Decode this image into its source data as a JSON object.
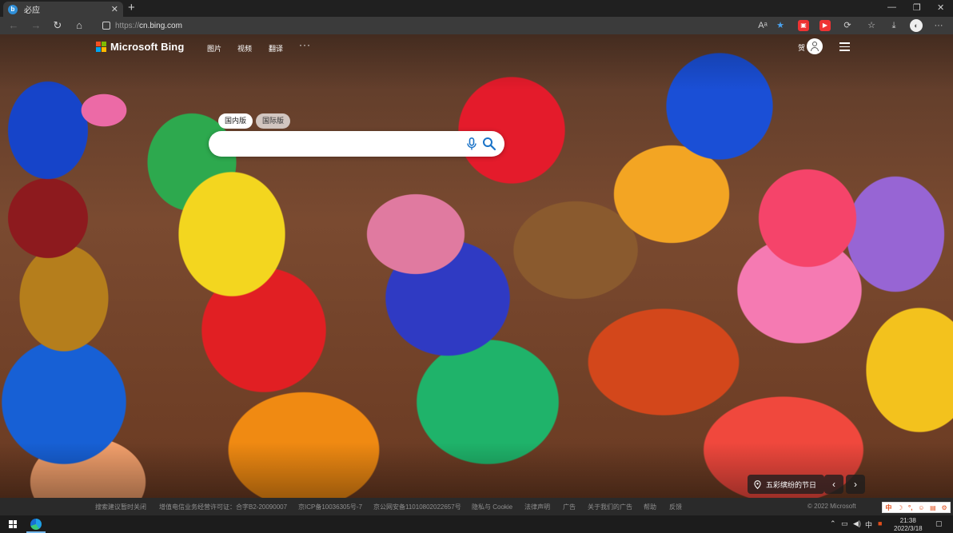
{
  "browser": {
    "tab_title": "必应",
    "tab_favicon": "b",
    "new_tab": "+",
    "url_protocol": "https://",
    "url_host": "cn.bing.com",
    "window_controls": [
      "—",
      "❐",
      "✕"
    ]
  },
  "header": {
    "logo_text": "Microsoft Bing",
    "logo_colors": [
      "#f25022",
      "#7fba00",
      "#00a4ef",
      "#ffb900"
    ],
    "nav": [
      "图片",
      "视频",
      "翻译"
    ],
    "more": "···",
    "user_label": "贺"
  },
  "search": {
    "scopes": [
      "国内版",
      "国际版"
    ],
    "active_scope": "国内版",
    "placeholder": ""
  },
  "image_info": {
    "location_label": "五彩缤纷的节日",
    "prev": "‹",
    "next": "›"
  },
  "footer": {
    "links": [
      "搜索建议暂时关闭",
      "增值电信业务经营许可证：合字B2-20090007",
      "京ICP备10036305号-7",
      "京公网安备11010802022657号",
      "隐私与 Cookie",
      "法律声明",
      "广告",
      "关于我们的广告",
      "帮助",
      "反馈"
    ],
    "copyright": "© 2022 Microsoft"
  },
  "ime": [
    "中",
    "☽",
    "°,",
    "☺",
    "▤",
    "⚙"
  ],
  "taskbar": {
    "tray_input": "中",
    "time": "21:38",
    "date": "2022/3/18"
  }
}
